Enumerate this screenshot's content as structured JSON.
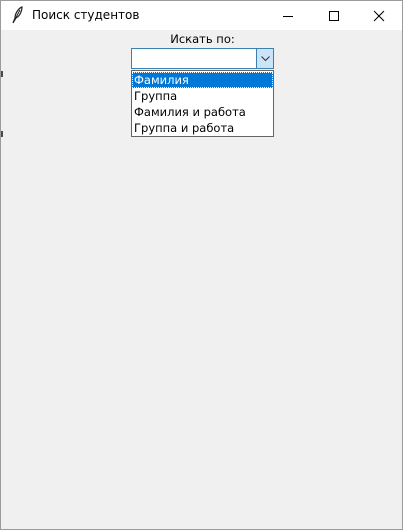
{
  "window": {
    "title": "Поиск студентов"
  },
  "search": {
    "label": "Искать по:",
    "combo_value": "",
    "options": [
      {
        "label": "Фамилия",
        "selected": true
      },
      {
        "label": "Группа",
        "selected": false
      },
      {
        "label": "Фамилия и работа",
        "selected": false
      },
      {
        "label": "Группа и работа",
        "selected": false
      }
    ]
  },
  "colors": {
    "selection": "#0078d7",
    "window_bg": "#f0f0f0",
    "combo_button": "#cce4f7"
  }
}
